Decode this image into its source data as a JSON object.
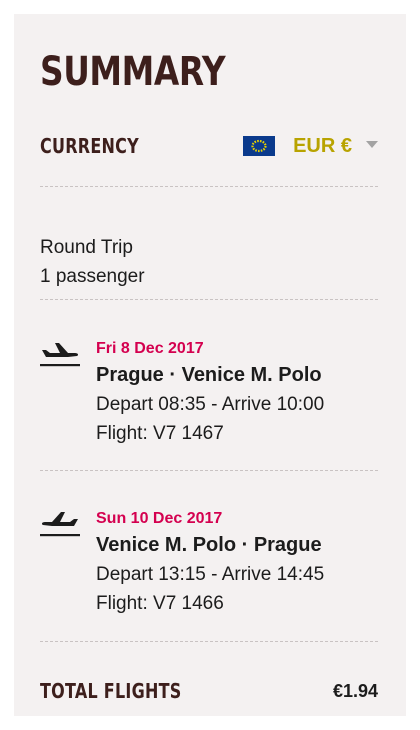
{
  "summary": {
    "title": "SUMMARY"
  },
  "currency": {
    "label": "CURRENCY",
    "selected": "EUR €",
    "flag_icon": "eu-flag-icon",
    "flag_bg": "#0a3a8c",
    "flag_mark": "#e8d100"
  },
  "trip": {
    "type": "Round Trip",
    "passengers": "1 passenger"
  },
  "segments": [
    {
      "date": "Fri 8 Dec 2017",
      "route": "Prague · Venice M. Polo",
      "times": "Depart 08:35 - Arrive 10:00",
      "flight": "Flight: V7 1467",
      "icon": "plane-departure-icon"
    },
    {
      "date": "Sun 10 Dec 2017",
      "route": "Venice M. Polo · Prague",
      "times": "Depart 13:15 - Arrive 14:45",
      "flight": "Flight: V7 1466",
      "icon": "plane-return-icon"
    }
  ],
  "total": {
    "label": "TOTAL FLIGHTS",
    "amount": "€1.94"
  },
  "colors": {
    "heading": "#3d1f1c",
    "accent_date": "#d4004f",
    "currency_value": "#b8a300",
    "panel_bg": "#f4f1f1"
  }
}
